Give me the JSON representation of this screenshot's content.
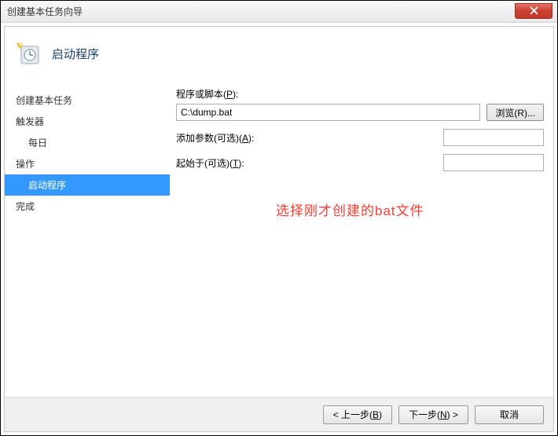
{
  "window": {
    "title": "创建基本任务向导"
  },
  "header": {
    "title": "启动程序"
  },
  "sidebar": {
    "items": [
      {
        "label": "创建基本任务",
        "level": 0,
        "selected": false
      },
      {
        "label": "触发器",
        "level": 0,
        "selected": false
      },
      {
        "label": "每日",
        "level": 1,
        "selected": false
      },
      {
        "label": "操作",
        "level": 0,
        "selected": false
      },
      {
        "label": "启动程序",
        "level": 1,
        "selected": true
      },
      {
        "label": "完成",
        "level": 0,
        "selected": false
      }
    ]
  },
  "form": {
    "program_label_pre": "程序或脚本(",
    "program_label_key": "P",
    "program_label_post": "):",
    "program_value": "C:\\dump.bat",
    "browse_pre": "浏览(",
    "browse_key": "R",
    "browse_post": ")...",
    "args_label_pre": "添加参数(可选)(",
    "args_label_key": "A",
    "args_label_post": "):",
    "args_value": "",
    "startin_label_pre": "起始于(可选)(",
    "startin_label_key": "T",
    "startin_label_post": "):",
    "startin_value": ""
  },
  "annotation": "选择刚才创建的bat文件",
  "footer": {
    "back_pre": "< 上一步(",
    "back_key": "B",
    "back_post": ")",
    "next_pre": "下一步(",
    "next_key": "N",
    "next_post": ") >",
    "cancel": "取消"
  }
}
